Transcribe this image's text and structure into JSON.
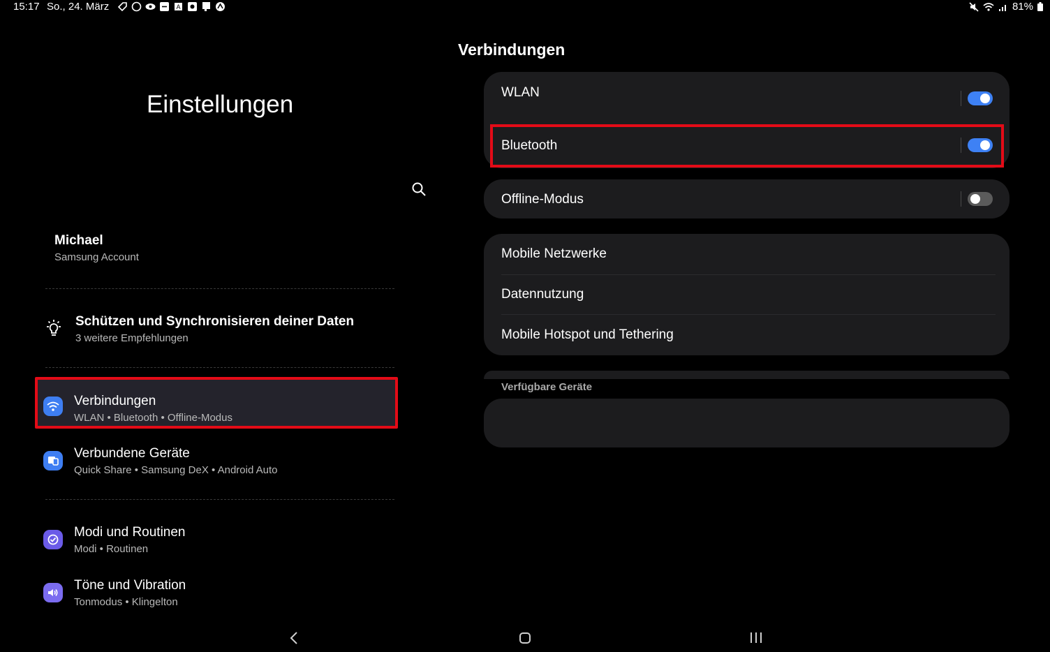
{
  "status_bar": {
    "time": "15:17",
    "date": "So., 24. März",
    "battery": "81%",
    "icons": [
      "tag-icon",
      "circle-icon",
      "eye-icon",
      "screen-icon",
      "a-icon",
      "dex-icon",
      "notes-icon",
      "game-icon"
    ]
  },
  "left": {
    "title": "Einstellungen",
    "account": {
      "name": "Michael",
      "subtitle": "Samsung Account"
    },
    "tip": {
      "title": "Schützen und Synchronisieren deiner Daten",
      "subtitle": "3 weitere Empfehlungen"
    },
    "menu": [
      {
        "title": "Verbindungen",
        "subtitle": "WLAN  •  Bluetooth  •  Offline-Modus",
        "icon": "wifi-icon",
        "color": "#3e7ef2"
      },
      {
        "title": "Verbundene Geräte",
        "subtitle": "Quick Share  •  Samsung DeX  •  Android Auto",
        "icon": "devices-icon",
        "color": "#3e7ef2"
      },
      {
        "title": "Modi und Routinen",
        "subtitle": "Modi  •  Routinen",
        "icon": "routines-icon",
        "color": "#6b5be8"
      },
      {
        "title": "Töne und Vibration",
        "subtitle": "Tonmodus  •  Klingelton",
        "icon": "sound-icon",
        "color": "#7b6cf0"
      }
    ]
  },
  "right": {
    "title": "Verbindungen",
    "toggles": [
      {
        "label": "WLAN",
        "state": "on"
      },
      {
        "label": "Bluetooth",
        "state": "on"
      },
      {
        "label": "Offline-Modus",
        "state": "off"
      }
    ],
    "network_items": [
      "Mobile Netzwerke",
      "Datennutzung",
      "Mobile Hotspot und Tethering"
    ],
    "section_label": "Verfügbare Geräte"
  },
  "colors": {
    "accent": "#3e81f4",
    "highlight": "#e30b17"
  }
}
